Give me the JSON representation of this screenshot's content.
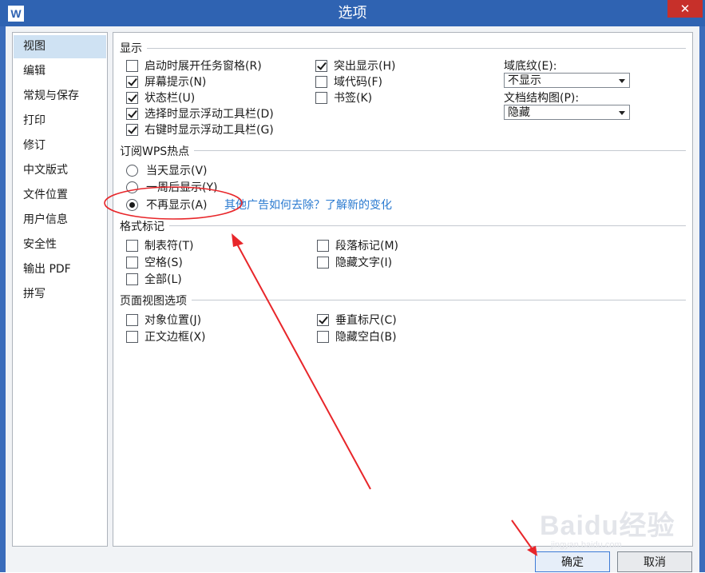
{
  "window": {
    "app_icon": "W",
    "title": "选项",
    "close_glyph": "✕"
  },
  "sidebar": {
    "items": [
      {
        "label": "视图"
      },
      {
        "label": "编辑"
      },
      {
        "label": "常规与保存"
      },
      {
        "label": "打印"
      },
      {
        "label": "修订"
      },
      {
        "label": "中文版式"
      },
      {
        "label": "文件位置"
      },
      {
        "label": "用户信息"
      },
      {
        "label": "安全性"
      },
      {
        "label": "输出 PDF"
      },
      {
        "label": "拼写"
      }
    ],
    "selected": "视图"
  },
  "display": {
    "title": "显示",
    "left_options": [
      {
        "label": "启动时展开任务窗格(R)",
        "checked": false
      },
      {
        "label": "屏幕提示(N)",
        "checked": true
      },
      {
        "label": "状态栏(U)",
        "checked": true
      },
      {
        "label": "选择时显示浮动工具栏(D)",
        "checked": true
      },
      {
        "label": "右键时显示浮动工具栏(G)",
        "checked": true
      }
    ],
    "mid_options": [
      {
        "label": "突出显示(H)",
        "checked": true
      },
      {
        "label": "域代码(F)",
        "checked": false
      },
      {
        "label": "书签(K)",
        "checked": false
      }
    ],
    "field_shading_label": "域底纹(E):",
    "field_shading_value": "不显示",
    "doc_map_label": "文档结构图(P):",
    "doc_map_value": "隐藏"
  },
  "subscribe": {
    "title": "订阅WPS热点",
    "options": [
      {
        "label": "当天显示(V)",
        "checked": false
      },
      {
        "label": "一周后显示(Y)",
        "checked": false
      },
      {
        "label": "不再显示(A)",
        "checked": true
      }
    ],
    "link_text": "其他广告如何去除？了解新的变化"
  },
  "format_marks": {
    "title": "格式标记",
    "left_options": [
      {
        "label": "制表符(T)",
        "checked": false
      },
      {
        "label": "空格(S)",
        "checked": false
      },
      {
        "label": "全部(L)",
        "checked": false
      }
    ],
    "mid_options": [
      {
        "label": "段落标记(M)",
        "checked": false
      },
      {
        "label": "隐藏文字(I)",
        "checked": false
      }
    ]
  },
  "page_view": {
    "title": "页面视图选项",
    "left_options": [
      {
        "label": "对象位置(J)",
        "checked": false
      },
      {
        "label": "正文边框(X)",
        "checked": false
      }
    ],
    "mid_options": [
      {
        "label": "垂直标尺(C)",
        "checked": true
      },
      {
        "label": "隐藏空白(B)",
        "checked": false
      }
    ]
  },
  "buttons": {
    "ok": "确定",
    "cancel": "取消"
  },
  "watermark": {
    "text": "Baidu经验",
    "sub": "jingyan.baidu.com"
  },
  "annotation_color": "#e8262a"
}
